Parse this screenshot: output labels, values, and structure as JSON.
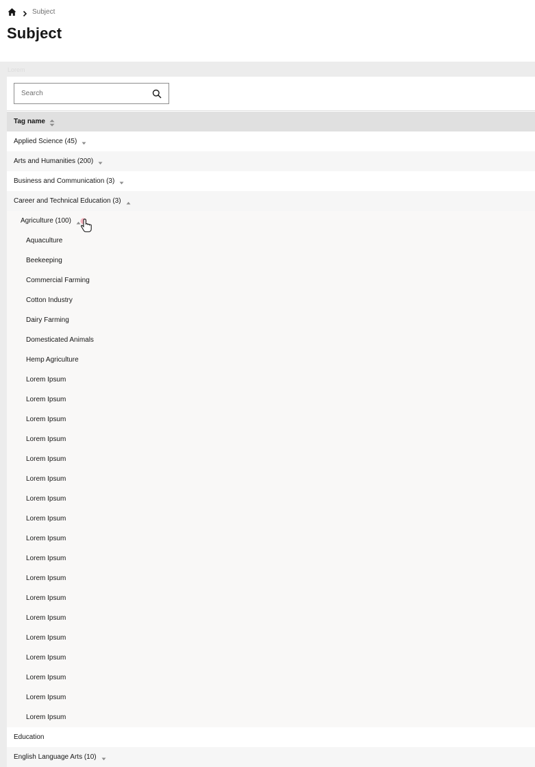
{
  "breadcrumb": {
    "home_icon": "home-icon",
    "separator_icon": "chevron-right-icon",
    "current": "Subject"
  },
  "page": {
    "title": "Subject",
    "band_label": "Lorem"
  },
  "search": {
    "placeholder": "Search",
    "value": "",
    "icon": "search-icon"
  },
  "table": {
    "column_header": "Tag name",
    "sort_icon": "sort-icon",
    "rows": [
      {
        "label": "Applied Science (45)",
        "level": 0,
        "expandable": true,
        "expanded": false
      },
      {
        "label": "Arts and Humanities (200)",
        "level": 0,
        "expandable": true,
        "expanded": false
      },
      {
        "label": "Business and Communication (3)",
        "level": 0,
        "expandable": true,
        "expanded": false
      },
      {
        "label": "Career and Technical Education (3)",
        "level": 0,
        "expandable": true,
        "expanded": true
      },
      {
        "label": "Agriculture (100)",
        "level": 1,
        "expandable": true,
        "expanded": true
      },
      {
        "label": "Aquaculture",
        "level": 2
      },
      {
        "label": "Beekeeping",
        "level": 2
      },
      {
        "label": "Commercial Farming",
        "level": 2
      },
      {
        "label": "Cotton Industry",
        "level": 2
      },
      {
        "label": "Dairy Farming",
        "level": 2
      },
      {
        "label": "Domesticated Animals",
        "level": 2
      },
      {
        "label": "Hemp Agriculture",
        "level": 2
      },
      {
        "label": "Lorem Ipsum",
        "level": 2
      },
      {
        "label": "Lorem Ipsum",
        "level": 2
      },
      {
        "label": "Lorem Ipsum",
        "level": 2
      },
      {
        "label": "Lorem Ipsum",
        "level": 2
      },
      {
        "label": "Lorem Ipsum",
        "level": 2
      },
      {
        "label": "Lorem Ipsum",
        "level": 2
      },
      {
        "label": "Lorem Ipsum",
        "level": 2
      },
      {
        "label": "Lorem Ipsum",
        "level": 2
      },
      {
        "label": "Lorem Ipsum",
        "level": 2
      },
      {
        "label": "Lorem Ipsum",
        "level": 2
      },
      {
        "label": "Lorem Ipsum",
        "level": 2
      },
      {
        "label": "Lorem Ipsum",
        "level": 2
      },
      {
        "label": "Lorem Ipsum",
        "level": 2
      },
      {
        "label": "Lorem Ipsum",
        "level": 2
      },
      {
        "label": "Lorem Ipsum",
        "level": 2
      },
      {
        "label": "Lorem Ipsum",
        "level": 2
      },
      {
        "label": "Lorem Ipsum",
        "level": 2
      },
      {
        "label": "Lorem Ipsum",
        "level": 2
      },
      {
        "label": "Education",
        "level": 0,
        "expandable": false
      },
      {
        "label": "English Language Arts (10)",
        "level": 0,
        "expandable": true,
        "expanded": false
      }
    ]
  },
  "colors": {
    "header_bg": "#e0e0e0",
    "band_bg": "#ececec",
    "text": "#161616",
    "muted": "#6f6f6f",
    "caret": "#8d8d8d"
  }
}
